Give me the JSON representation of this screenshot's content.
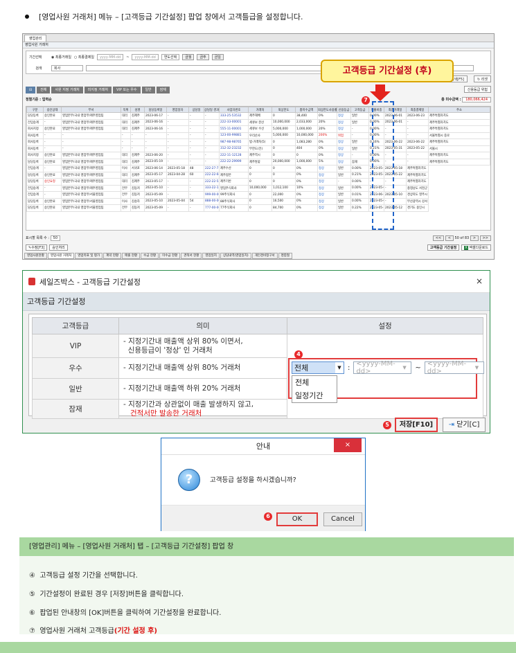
{
  "heading": "[영업사원 거래처] 메뉴 – [고객등급 기간설정] 팝업 창에서 고객틀급을 설정합니다.",
  "callout": "고객등급 기간설정 (후)",
  "badges": {
    "b4": "4",
    "b5": "5",
    "b6": "6",
    "b7": "7"
  },
  "app": {
    "tab": "영업관리",
    "subtitle": "영업사원 거래처",
    "period_label": "기간선택",
    "radio1": "최종거래일",
    "radio2": "최종결제일",
    "date_placeholder": "yyyy-MM-dd",
    "year_select": "연도선택",
    "btn_week": "금월",
    "btn_prev": "금주",
    "btn_day": "금일",
    "search_label": "검색",
    "search_value": "회사",
    "search_btn": "검색[F5]",
    "reset_btn": "리셋",
    "filter_tabs": [
      "전체",
      "사원 지정 거래처",
      "미지정 거래처",
      "VIP 또는 우수",
      "일반",
      "잠재"
    ],
    "credit_btn": "신용등급 위험",
    "sort_label": "정렬기준 : 입력순",
    "total_label": "총 미수금액 :",
    "total_value": "180,066,424",
    "columns": [
      "구분",
      "승인상태",
      "부서",
      "직위",
      "성명",
      "담당등록일",
      "영업일자",
      "상담일",
      "상담일 경과일수",
      "사업자번호",
      "거래처",
      "외상한도",
      "총미수금액",
      "외상한도사용률",
      "신용등급",
      "고객등급",
      "매출비중",
      "최종거래일",
      "최종결제일",
      "주소"
    ],
    "rows": [
      [
        "담당등록",
        "승인완료",
        "영업본부/국내 영업부/제주영업팀",
        "대리",
        "김제주",
        "2023-06-17",
        "-",
        "-",
        "-",
        "333-25-53532",
        "제주해배",
        "0",
        "38,400",
        "0%",
        "정상",
        "일반",
        "0.00%",
        "2023-06-01",
        "2023-06-23",
        "제주특별자치도"
      ],
      [
        "전임승계",
        "-",
        "영업본부/국내 영업부/제주영업팀",
        "대리",
        "김제주",
        "2023-06-16",
        "-",
        "-",
        "-",
        "222-33-00001",
        "세큐보 분산",
        "10,000,000",
        "2,033,000",
        "20%",
        "정상",
        "일반",
        "0.00%",
        "2023-06-01",
        "-",
        "제주특별자치도"
      ],
      [
        "회사지정",
        "승인완료",
        "영업본부/국내 영업부/제주영업팀",
        "대리",
        "김제주",
        "2023-06-16",
        "-",
        "-",
        "-",
        "555-11-00001",
        "세큐보 수선",
        "5,000,000",
        "1,000,000",
        "20%",
        "정상",
        "-",
        "0.00%",
        "-",
        "-",
        "제주특별자치도"
      ],
      [
        "회사등록",
        "-",
        "-",
        "-",
        "-",
        "-",
        "-",
        "-",
        "-",
        "123-00-99881",
        "우리산사",
        "5,000,000",
        "10,000,000",
        "200%",
        "위험",
        "-",
        "0.00%",
        "-",
        "-",
        "서울특별시 중로"
      ],
      [
        "회사등록",
        "-",
        "-",
        "-",
        "-",
        "-",
        "-",
        "-",
        "-",
        "987-98-98765",
        "법-거래처(5)",
        "0",
        "1,083,280",
        "0%",
        "정상",
        "일반",
        "0.16%",
        "2023-06-22",
        "2023-06-22",
        "제주특별자치도"
      ],
      [
        "회사등록",
        "-",
        "-",
        "-",
        "-",
        "-",
        "-",
        "-",
        "-",
        "312-32-23232",
        "무한도(전)",
        "0",
        "404",
        "0%",
        "정상",
        "일반",
        "0.21%",
        "2023-05-31",
        "2023-05-22",
        "서울시"
      ],
      [
        "회사지정",
        "승인완료",
        "영업본부/국내 영업부/제주영업팀",
        "대리",
        "김제주",
        "2023-06-20",
        "-",
        "-",
        "-",
        "222-11-12128",
        "제주역시",
        "0",
        "0",
        "0%",
        "정상",
        "-",
        "0.00%",
        "-",
        "-",
        "제주특별자치도"
      ],
      [
        "담당등록",
        "승인완료",
        "영업본부/국내 영업부/제주영업팀",
        "대리",
        "김제주",
        "2023-05-19",
        "-",
        "-",
        "-",
        "222-22-29999",
        "제주쌍꽃",
        "20,000,000",
        "1,000,000",
        "5%",
        "정상",
        "잠재",
        "0.00%",
        "-",
        "-",
        "제주특별자치도"
      ],
      [
        "전임승계",
        "-",
        "영업본부/국내 영업부/제주영업팀",
        "이사",
        "서귀포",
        "2023-06-14",
        "2023-05-18",
        "48",
        "222-27-77777",
        "제주수산",
        "0",
        "0",
        "0%",
        "정상",
        "일반",
        "0.00%",
        "2023-05-18",
        "2023-05-18",
        "제주특별자치도"
      ],
      [
        "담당등록",
        "승인완료",
        "영업본부/국내 영업부/제주영업팀",
        "대리",
        "김제주",
        "2023-05-17",
        "2023-04-28",
        "60",
        "222-22-66666",
        "제주정본",
        "0",
        "0",
        "0%",
        "정상",
        "일반",
        "0.21%",
        "2023-05-22",
        "2023-05-22",
        "제주특별자치도"
      ],
      [
        "담당등록",
        "승인요청",
        "영업본부/국내 영업부/제주영업팀",
        "대리",
        "김제주",
        "2023-05-17",
        "-",
        "-",
        "222-22-55555",
        "제주기반",
        "0",
        "0",
        "0%",
        "정상",
        "-",
        "0.00%",
        "-",
        "-",
        "제주특별자치도"
      ],
      [
        "전임승계",
        "-",
        "영업본부/국내 영업부/제주영업팀",
        "전무",
        "김동저",
        "2023-05-10",
        "-",
        "-",
        "333-22-12121",
        "영업주식회사",
        "10,000,000",
        "1,012,100",
        "10%",
        "정상",
        "일반",
        "0.00%",
        "2023-05-08",
        "-",
        "충청남도 서천군"
      ],
      [
        "전임승계",
        "-",
        "영업본부/국내 영업부/서울영업팀",
        "전무",
        "김동저",
        "2023-05-09",
        "-",
        "-",
        "999-00-00001",
        "99주식회사",
        "0",
        "22,000",
        "0%",
        "정상",
        "일반",
        "0.01%",
        "2023-06-26",
        "2023-05-10",
        "경상북도 영주시"
      ],
      [
        "담당등록",
        "승인완료",
        "영업본부/국내 영업부/서울영업팀",
        "이사",
        "김송하",
        "2023-05-10",
        "2023-05-04",
        "54",
        "888-00-00001",
        "88주식회사",
        "0",
        "16,500",
        "0%",
        "정상",
        "일반",
        "0.00%",
        "2023-05-04",
        "-",
        "부산광역시 강서"
      ],
      [
        "담당등록",
        "승인완료",
        "영업본부/국내 영업부/서울영업팀",
        "전무",
        "김동저",
        "2023-05-09",
        "-",
        "-",
        "777-00-00001",
        "77주식회사",
        "0",
        "84,700",
        "0%",
        "정상",
        "일반",
        "0.22%",
        "2023-05-16",
        "2023-05-12",
        "경기도 용인시"
      ]
    ],
    "page_size_label": "표시할 목록 수 :",
    "page_size": "50",
    "pager": "50 of 83",
    "edit_btn": "수정[F3]",
    "approve_btn": "승인처리",
    "grade_btn": "고객등급 기간설정",
    "excel_btn": "엑셀다운로드",
    "bottom_tabs": [
      "영업사원현황",
      "영업사원 거래처",
      "영업목표 및 평가",
      "계약 현황",
      "매출 현황",
      "수금 현황",
      "미수금 현황",
      "견적서 현황",
      "영업일지",
      "상담내역(영업일지)",
      "개인경비청구서",
      "명함철"
    ]
  },
  "dialog": {
    "title": "세일즈박스 - 고객등급 기간설정",
    "close": "×",
    "subtitle": "고객등급 기간설정",
    "col_grade": "고객등급",
    "col_meaning": "의미",
    "col_setting": "설정",
    "rows": [
      {
        "grade": "VIP",
        "meaning1": "- 지정기간내 매출액 상위 80% 이면서,",
        "meaning2": "  신용등급이 '정상' 인 거래처",
        "meaning3": ""
      },
      {
        "grade": "우수",
        "meaning1": "- 지정기간내 매출액 상위 80% 거래처",
        "meaning2": "",
        "meaning3": ""
      },
      {
        "grade": "일반",
        "meaning1": "- 지정기간내 매출액 하위 20% 거래처",
        "meaning2": "",
        "meaning3": ""
      },
      {
        "grade": "잠재",
        "meaning1": "- 지정기간과 상관없이 매출 발생하지 않고,",
        "meaning2": "",
        "meaning3": "건적서만 발송한 거래처"
      }
    ],
    "select_value": "전체",
    "colon": ":",
    "date_from": "<yyyy-MM-dd>",
    "tilde": "~",
    "date_to": "<yyyy-MM-dd>",
    "options": [
      "전체",
      "일정기간"
    ],
    "save_btn": "저장[F10]",
    "close_btn": "닫기[C]"
  },
  "alert": {
    "title": "안내",
    "close": "×",
    "message": "고객등급 설정을 하시겠습니까?",
    "ok": "OK",
    "cancel": "Cancel"
  },
  "description": {
    "header": "[영업관리] 메뉴 – [영업사원 거래처] 탭 – [고객등급 기간설정] 팝업 창",
    "items": [
      {
        "num": "④",
        "text": "고객등급 설정 기간을 선택합니다."
      },
      {
        "num": "⑤",
        "text": "기간설정이 완료된 경우 [저장]버튼을 클릭합니다."
      },
      {
        "num": "⑥",
        "text": "팝업된 안내창의 [OK]버튼을 클릭하여 기간설정을 완료합니다."
      },
      {
        "num": "⑦",
        "text": "영업사원 거래처 고객등급",
        "emph": "(기간 설정 후)"
      }
    ]
  }
}
